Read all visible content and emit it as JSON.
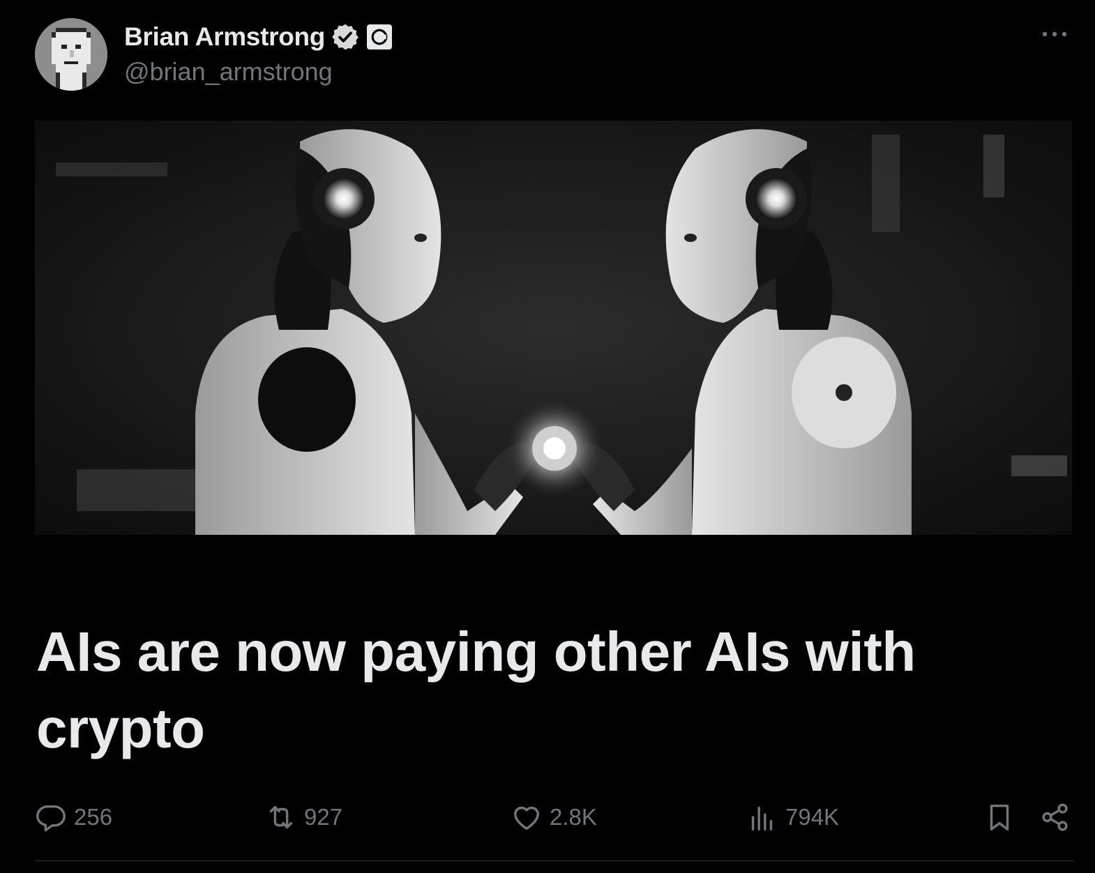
{
  "author": {
    "name": "Brian Armstrong",
    "handle": "@brian_armstrong",
    "verified": true,
    "affiliation_badge_icon": "coinbase-logo-icon",
    "avatar_icon": "pixel-face-avatar"
  },
  "post": {
    "headline": "AIs are now paying other AIs with crypto",
    "media_icon": "two-robots-exchanging-glowing-orb-image"
  },
  "actions": {
    "reply_count": "256",
    "repost_count": "927",
    "like_count": "2.8K",
    "view_count": "794K"
  },
  "colors": {
    "background": "#000000",
    "text_primary": "#e7e9ea",
    "text_secondary": "#71767b",
    "divider": "#2f3336"
  }
}
